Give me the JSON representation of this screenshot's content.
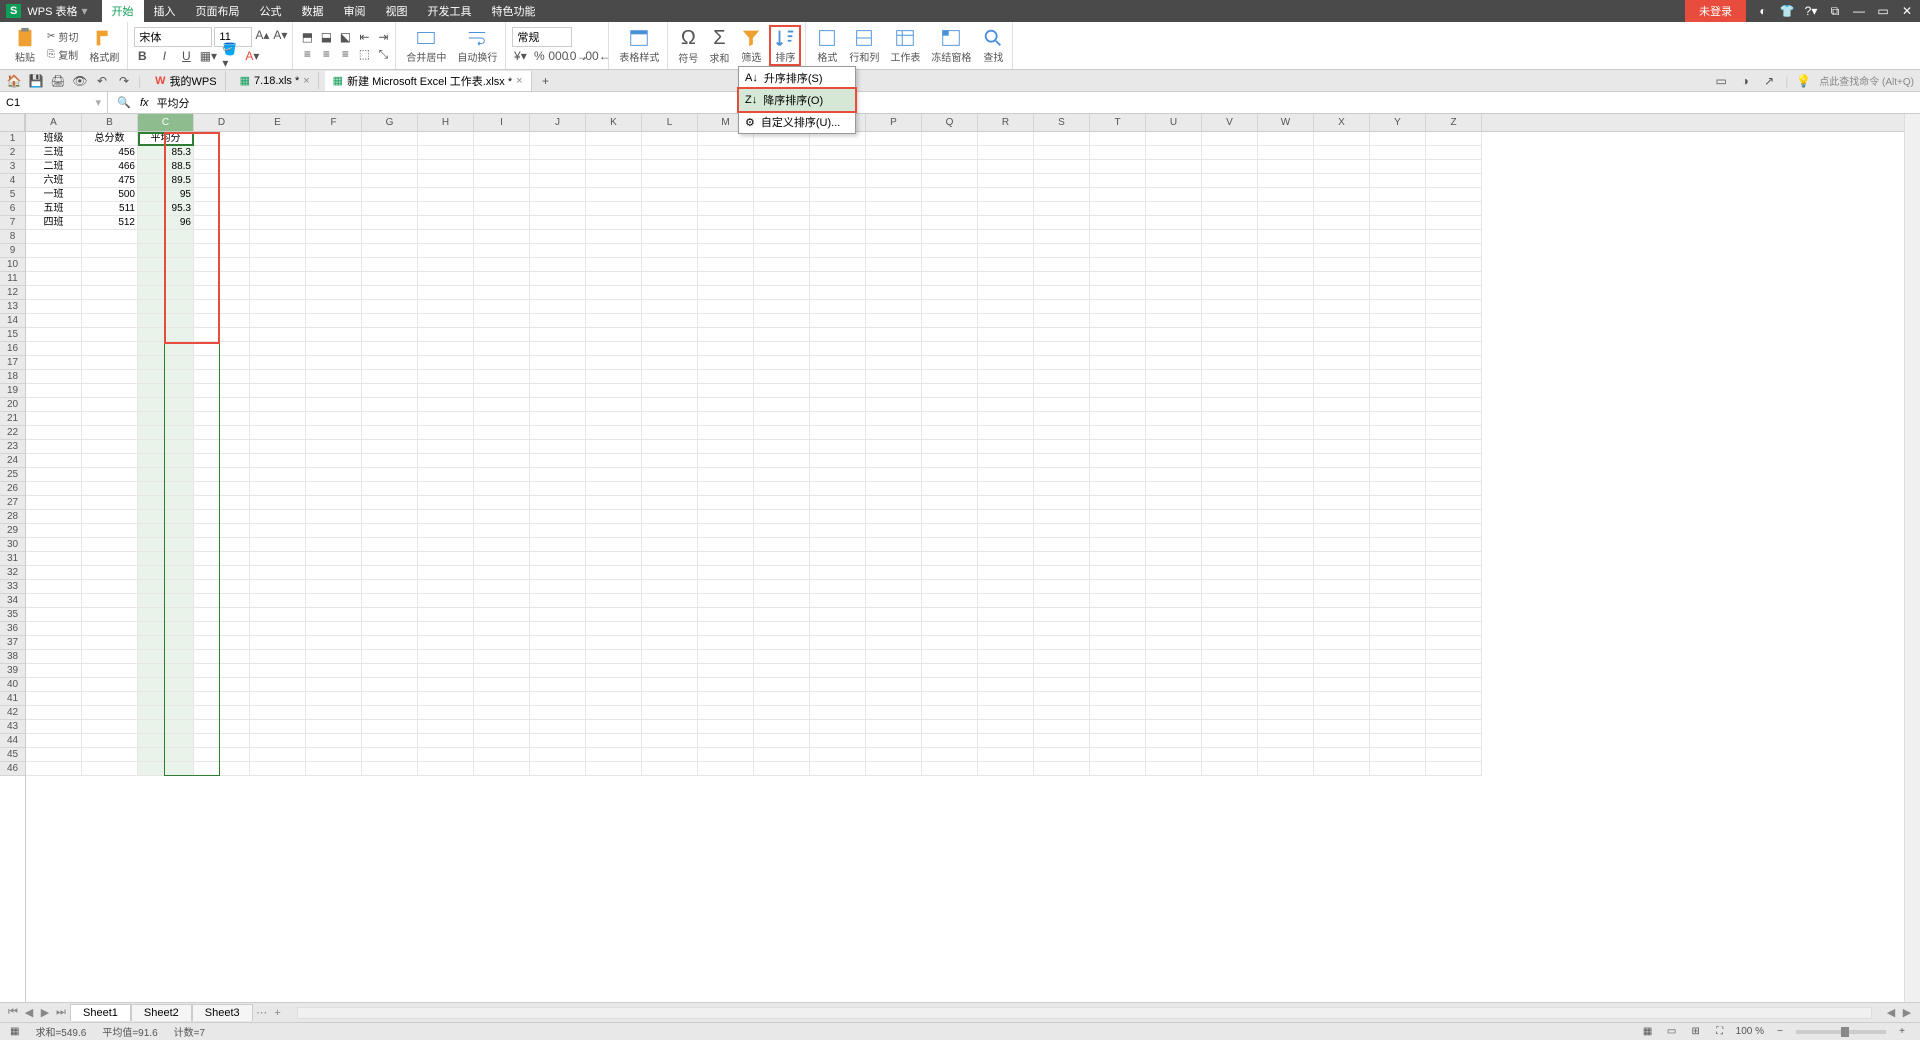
{
  "app": {
    "name": "WPS 表格",
    "login": "未登录"
  },
  "menu": [
    "开始",
    "插入",
    "页面布局",
    "公式",
    "数据",
    "审阅",
    "视图",
    "开发工具",
    "特色功能"
  ],
  "menu_active_index": 0,
  "ribbon": {
    "paste": "粘贴",
    "cut": "剪切",
    "copy": "复制",
    "format_painter": "格式刷",
    "font_name": "宋体",
    "font_size": "11",
    "merge": "合并居中",
    "wrap": "自动换行",
    "general": "常规",
    "table_style": "表格样式",
    "symbol": "符号",
    "sum": "求和",
    "filter": "筛选",
    "sort": "排序",
    "format": "格式",
    "rowcol": "行和列",
    "worksheet": "工作表",
    "freeze": "冻结窗格",
    "find": "查找"
  },
  "sort_menu": {
    "asc": "升序排序(S)",
    "desc": "降序排序(O)",
    "custom": "自定义排序(U)..."
  },
  "qat_tabs": {
    "mywps": "我的WPS",
    "doc1": "7.18.xls *",
    "doc2": "新建 Microsoft Excel 工作表.xlsx *"
  },
  "namebox": "C1",
  "formula": "平均分",
  "columns": [
    "A",
    "B",
    "C",
    "D",
    "E",
    "F",
    "G",
    "H",
    "I",
    "J",
    "K",
    "L",
    "M",
    "N",
    "O",
    "P",
    "Q",
    "R",
    "S",
    "T",
    "U",
    "V",
    "W",
    "X",
    "Y",
    "Z"
  ],
  "selected_col_index": 2,
  "data_rows": [
    {
      "a": "班级",
      "b": "总分数",
      "c": "平均分"
    },
    {
      "a": "三班",
      "b": "456",
      "c": "85.3"
    },
    {
      "a": "二班",
      "b": "466",
      "c": "88.5"
    },
    {
      "a": "六班",
      "b": "475",
      "c": "89.5"
    },
    {
      "a": "一班",
      "b": "500",
      "c": "95"
    },
    {
      "a": "五班",
      "b": "511",
      "c": "95.3"
    },
    {
      "a": "四班",
      "b": "512",
      "c": "96"
    }
  ],
  "total_rows": 46,
  "sheets": [
    "Sheet1",
    "Sheet2",
    "Sheet3"
  ],
  "active_sheet": 0,
  "status": {
    "sum_label": "求和=",
    "sum": "549.6",
    "avg_label": "平均值=",
    "avg": "91.6",
    "count_label": "计数=",
    "count": "7",
    "zoom": "100 %"
  },
  "search_hint": "点此查找命令 (Alt+Q)"
}
